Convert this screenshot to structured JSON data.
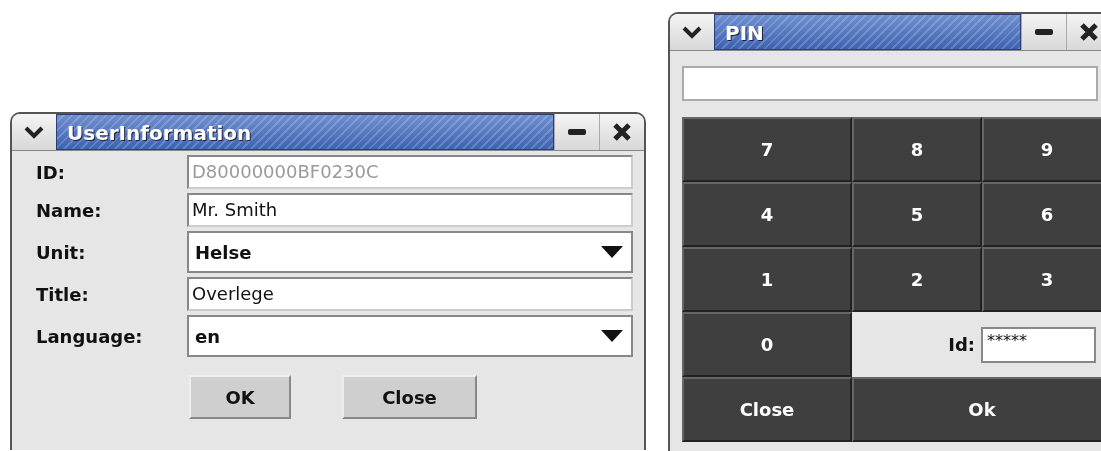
{
  "windows": [
    {
      "title": "UserInformation",
      "kind": "form",
      "fields": [
        {
          "label": "ID:",
          "kind": "text",
          "value": "D80000000BF0230C",
          "disabled": true
        },
        {
          "label": "Name:",
          "kind": "text",
          "value": "Mr. Smith",
          "disabled": false
        },
        {
          "label": "Unit:",
          "kind": "dropdown",
          "value": "Helse",
          "disabled": false
        },
        {
          "label": "Title:",
          "kind": "text",
          "value": "Overlege",
          "disabled": false
        },
        {
          "label": "Language:",
          "kind": "dropdown",
          "value": "en",
          "disabled": false
        }
      ],
      "buttons": [
        "OK",
        "Close"
      ]
    },
    {
      "title": "PIN",
      "kind": "keypad",
      "keys": [
        "7",
        "8",
        "9",
        "4",
        "5",
        "6",
        "1",
        "2",
        "3",
        "0"
      ],
      "id_field": {
        "label": "Id:",
        "value": "*****"
      },
      "buttons": [
        "Close",
        "Ok"
      ]
    }
  ]
}
